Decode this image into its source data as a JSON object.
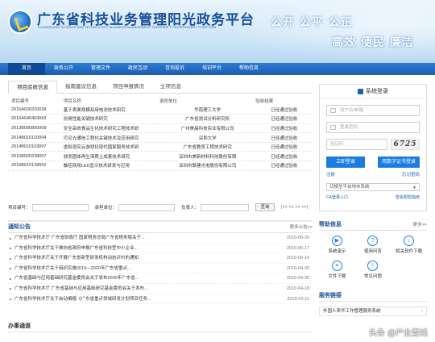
{
  "header": {
    "title": "广东省科技业务管理阳光政务平台",
    "subtitle": "GUANGDONG SCIENCE AND TECHNOLOGY BUSINESS MANAGEMENT SUNSHINE E-GOVERNMENT PLATFORM",
    "slogan_line1": "公开 公平 公正",
    "slogan_line2": "高效 便民 廉洁"
  },
  "nav": {
    "items": [
      {
        "label": "首页"
      },
      {
        "label": "政务公开"
      },
      {
        "label": "管理文件"
      },
      {
        "label": "政民互动"
      },
      {
        "label": "咨询投诉"
      },
      {
        "label": "培训平台"
      },
      {
        "label": "帮助信息"
      }
    ]
  },
  "tabs": [
    {
      "label": "项目验收信息"
    },
    {
      "label": "指南建议信息"
    },
    {
      "label": "项目申报情况"
    },
    {
      "label": "立项信息"
    }
  ],
  "table": {
    "headers": [
      "项目编号",
      "项目名称",
      "承担单位",
      "验收结果"
    ],
    "rows": [
      [
        "2015A020210039",
        "基于表面规模双用电池技术研究",
        "华南理工大学",
        "已经通过验收"
      ],
      [
        "2016A040403063",
        "抗骨性能关键技术研究",
        "广东省测试分析研究所",
        "已经通过验收"
      ],
      [
        "2013B090800009",
        "安全高效食品生化技术研究工程技术研",
        "广州美晨科技实业有限公司",
        "已经通过验收"
      ],
      [
        "2014B010120004",
        "可见光通信工程化关键技术及应用研究",
        "深圳大学",
        "已经通过验收"
      ],
      [
        "2014B010103007",
        "虚拟现实云游戏化现代国家服务技术研",
        "广东省教育工程技术研究",
        "已经通过验收"
      ],
      [
        "2015B020238007",
        "放而固体再生清质土成套技术研究",
        "深圳市美新材料科技股份有限",
        "已经通过验收"
      ],
      [
        "2016B010128002",
        "触控商用LED显示技术研发与应用",
        "深圳市联建光电股份有限公司",
        "已经通过验收"
      ]
    ]
  },
  "filter": {
    "label_no": "项目编号：",
    "label_unit": "承担单位：",
    "label_person": "负责人：",
    "query_button": "查询",
    "pager": "|<< << >> >>|"
  },
  "notices": {
    "title": "通知公告",
    "more": "更多公告>>",
    "items": [
      {
        "text": "广东省科学技术厅 广东省财政厅 国家税务总局广东省税务局关于...",
        "date": "2019-05-20"
      },
      {
        "text": "广东省科学技术厅关于做向省政府申报广东省科技型中小企业...",
        "date": "2019-05-17"
      },
      {
        "text": "广东省科学技术厅关于开展广东省新型研发机构动态评价的通知",
        "date": "2019-05-14"
      },
      {
        "text": "广东省科学技术厅关于组织实施2019—2020年广东省重点...",
        "date": "2019-04-30"
      },
      {
        "text": "广东省基础与应用基础研究基金委员会关于发布2020年广东省...",
        "date": "2019-04-30"
      },
      {
        "text": "广东省科学技术厅 广东省基础与应用基础研究基金委员会关于发布...",
        "date": "2019-04-18"
      },
      {
        "text": "广东省科学技术厅关于启动编报《广东省重点领域研发计划项目任务...",
        "date": "2019-03-11"
      }
    ]
  },
  "banshi": {
    "title": "办事通道"
  },
  "login": {
    "title": "系统登录",
    "username_placeholder": "用户名/邮箱",
    "password_placeholder": "登录密码",
    "captcha_placeholder": "验证码",
    "captcha_text": "6725",
    "login_button": "立即登录",
    "ca_button": "用数字证书登录",
    "register_link": "注册",
    "forgot_link": "忘记密码",
    "select_value": "切换至平台地市系统",
    "ca_link": "CA登录入口",
    "guide_link": "查看帮助指南"
  },
  "help": {
    "title": "帮助信息",
    "more": "更多>>",
    "items": [
      {
        "label": "系统演示",
        "glyph": "▶"
      },
      {
        "label": "使用问答",
        "glyph": "?"
      },
      {
        "label": "相关软件下载",
        "glyph": "↓"
      },
      {
        "label": "文件下载",
        "glyph": "≡"
      },
      {
        "label": "常见问题",
        "glyph": "!"
      }
    ]
  },
  "service": {
    "title": "服务链接",
    "item": "外国人来华工作管理服务系统"
  },
  "watermark": "头条 @产业壹线"
}
